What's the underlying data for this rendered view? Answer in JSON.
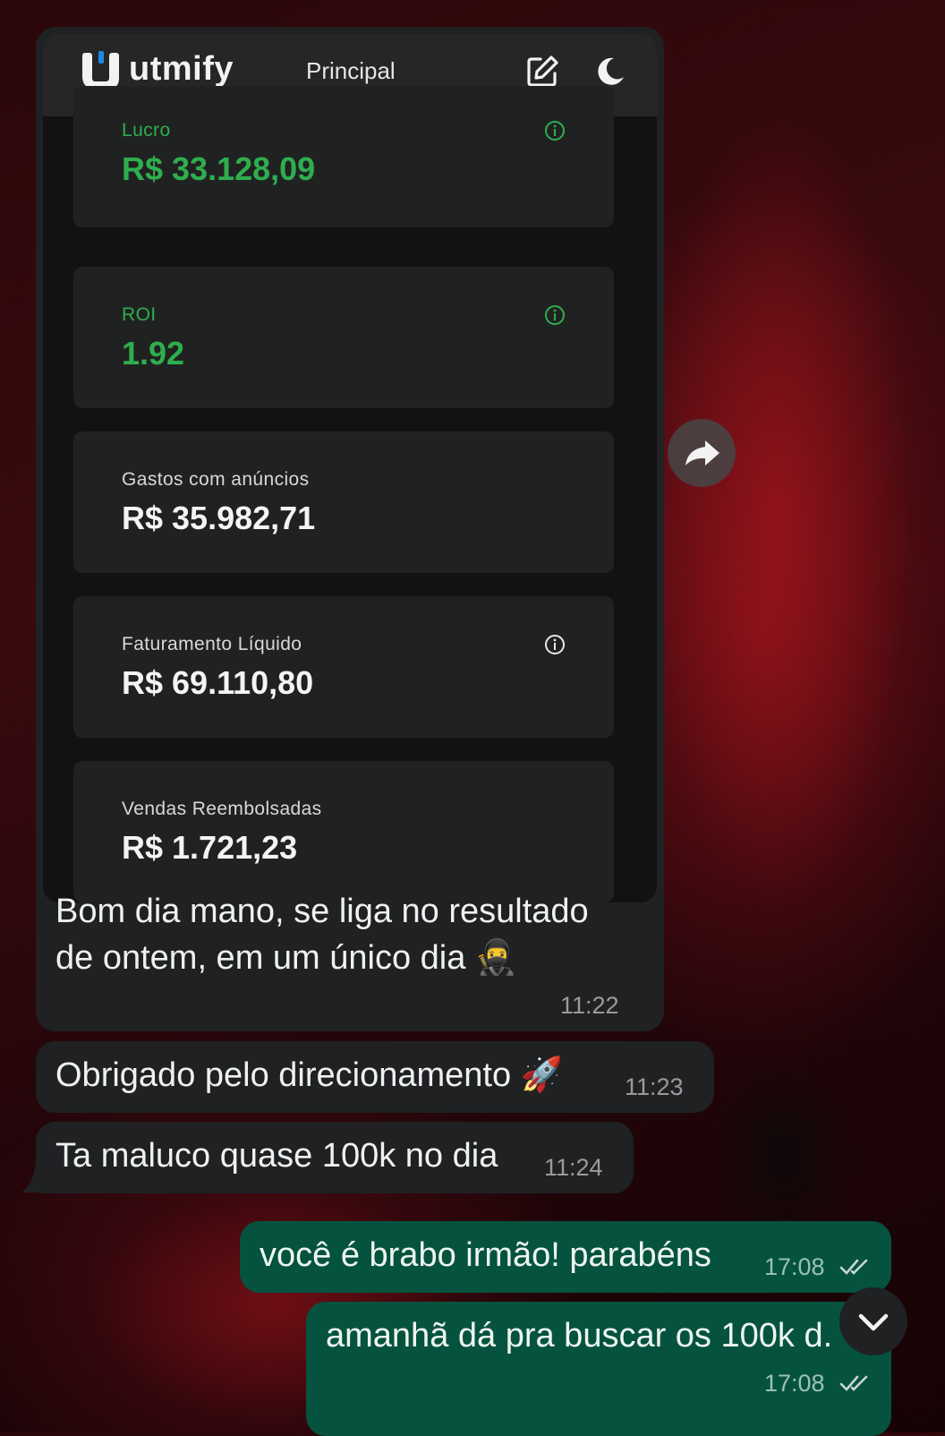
{
  "screenshot": {
    "brand": "utmify",
    "nav_title": "Principal",
    "icons": [
      "logo-icon",
      "edit-icon",
      "moon-icon",
      "info-icon"
    ],
    "cards": [
      {
        "label": "Lucro",
        "value": "R$ 33.128,09",
        "highlight": true,
        "info": true
      },
      {
        "label": "ROI",
        "value": "1.92",
        "highlight": true,
        "info": true
      },
      {
        "label": "Gastos com anúncios",
        "value": "R$ 35.982,71",
        "highlight": false,
        "info": false
      },
      {
        "label": "Faturamento Líquido",
        "value": "R$ 69.110,80",
        "highlight": false,
        "info": true
      },
      {
        "label": "Vendas Reembolsadas",
        "value": "R$ 1.721,23",
        "highlight": false,
        "info": false
      }
    ]
  },
  "messages": [
    {
      "direction": "incoming",
      "lines": [
        "Bom dia mano, se liga no resultado",
        "de ontem, em um único dia 🥷"
      ],
      "time": "11:22"
    },
    {
      "direction": "incoming",
      "text": "Obrigado pelo direcionamento 🚀",
      "time": "11:23"
    },
    {
      "direction": "incoming",
      "text": "Ta maluco quase 100k no dia",
      "time": "11:24"
    },
    {
      "direction": "outgoing",
      "text": "você é brabo irmão! parabéns",
      "time": "17:08",
      "status": "read"
    },
    {
      "direction": "outgoing",
      "text": "amanhã dá pra buscar os 100k d.",
      "time": "17:08",
      "status": "read"
    }
  ],
  "controls": {
    "forward_icon": "forward-icon",
    "scroll_down_icon": "chevron-down-icon"
  },
  "colors": {
    "accent_green": "#2fae4e",
    "incoming_bubble": "#1f2123",
    "outgoing_bubble": "#05533f",
    "read_ticks": "#c9d6cf"
  }
}
